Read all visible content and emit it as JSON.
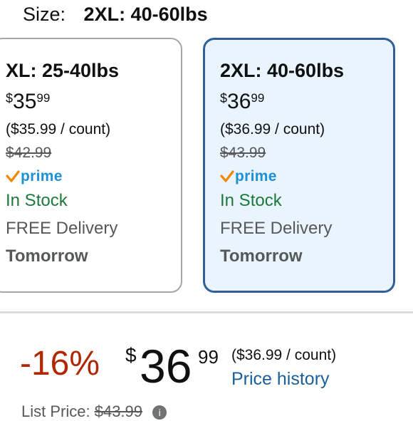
{
  "size_selector": {
    "label": "Size:",
    "selected": "2XL: 40-60lbs"
  },
  "options": [
    {
      "title": "XL: 25-40lbs",
      "price_symbol": "$",
      "price_whole": "35",
      "price_fraction": "99",
      "unit_price": "($35.99 / count)",
      "list_price": "$42.99",
      "prime_label": "prime",
      "stock": "In Stock",
      "delivery": "FREE Delivery",
      "delivery_day": "Tomorrow",
      "selected": false
    },
    {
      "title": "2XL: 40-60lbs",
      "price_symbol": "$",
      "price_whole": "36",
      "price_fraction": "99",
      "unit_price": "($36.99 / count)",
      "list_price": "$43.99",
      "prime_label": "prime",
      "stock": "In Stock",
      "delivery": "FREE Delivery",
      "delivery_day": "Tomorrow",
      "selected": true
    }
  ],
  "price_block": {
    "discount": "-16%",
    "symbol": "$",
    "whole": "36",
    "fraction": "99",
    "unit_price": "($36.99 / count)",
    "history_link": "Price history",
    "list_label": "List Price:",
    "list_price": "$43.99"
  },
  "colors": {
    "selected_border": "#2e5f97",
    "selected_bg": "#eaf4fe",
    "in_stock": "#1d7a3a",
    "discount": "#b12704",
    "prime_blue": "#1e90d6",
    "prime_check": "#f08804",
    "link": "#1a5e9a"
  }
}
